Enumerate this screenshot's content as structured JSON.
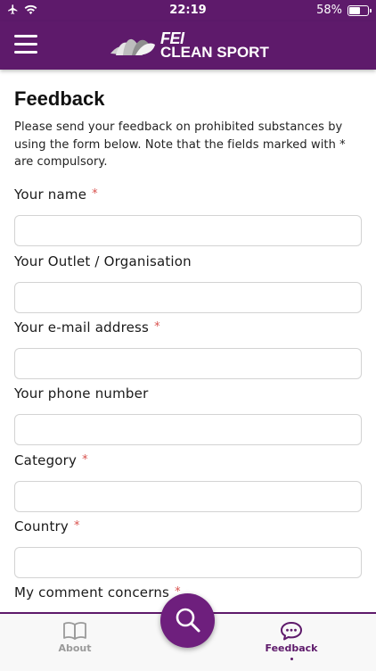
{
  "status_bar": {
    "time": "22:19",
    "battery_percent": "58%",
    "battery_level": 0.58,
    "icons": [
      "airplane-icon",
      "wifi-icon",
      "battery-icon"
    ]
  },
  "header": {
    "menu_icon": "hamburger-menu-icon",
    "logo_top": "FEI",
    "logo_bottom": "CLEAN SPORT"
  },
  "page": {
    "title": "Feedback",
    "intro": "Please send your feedback on prohibited substances by using the form below. Note that the fields marked with * are compulsory."
  },
  "form": {
    "required_mark": "*",
    "fields": [
      {
        "label": "Your name",
        "required": true,
        "value": ""
      },
      {
        "label": "Your Outlet / Organisation",
        "required": false,
        "value": ""
      },
      {
        "label": "Your e-mail address",
        "required": true,
        "value": ""
      },
      {
        "label": "Your phone number",
        "required": false,
        "value": ""
      },
      {
        "label": "Category",
        "required": true,
        "value": ""
      },
      {
        "label": "Country",
        "required": true,
        "value": ""
      },
      {
        "label": "My comment concerns",
        "required": true,
        "value": ""
      }
    ]
  },
  "bottom_nav": {
    "about_label": "About",
    "feedback_label": "Feedback",
    "active": "Feedback",
    "search_icon": "search-icon"
  },
  "colors": {
    "brand": "#5e1a6b",
    "required": "#d9534f",
    "inactive": "#9a9a9a"
  }
}
